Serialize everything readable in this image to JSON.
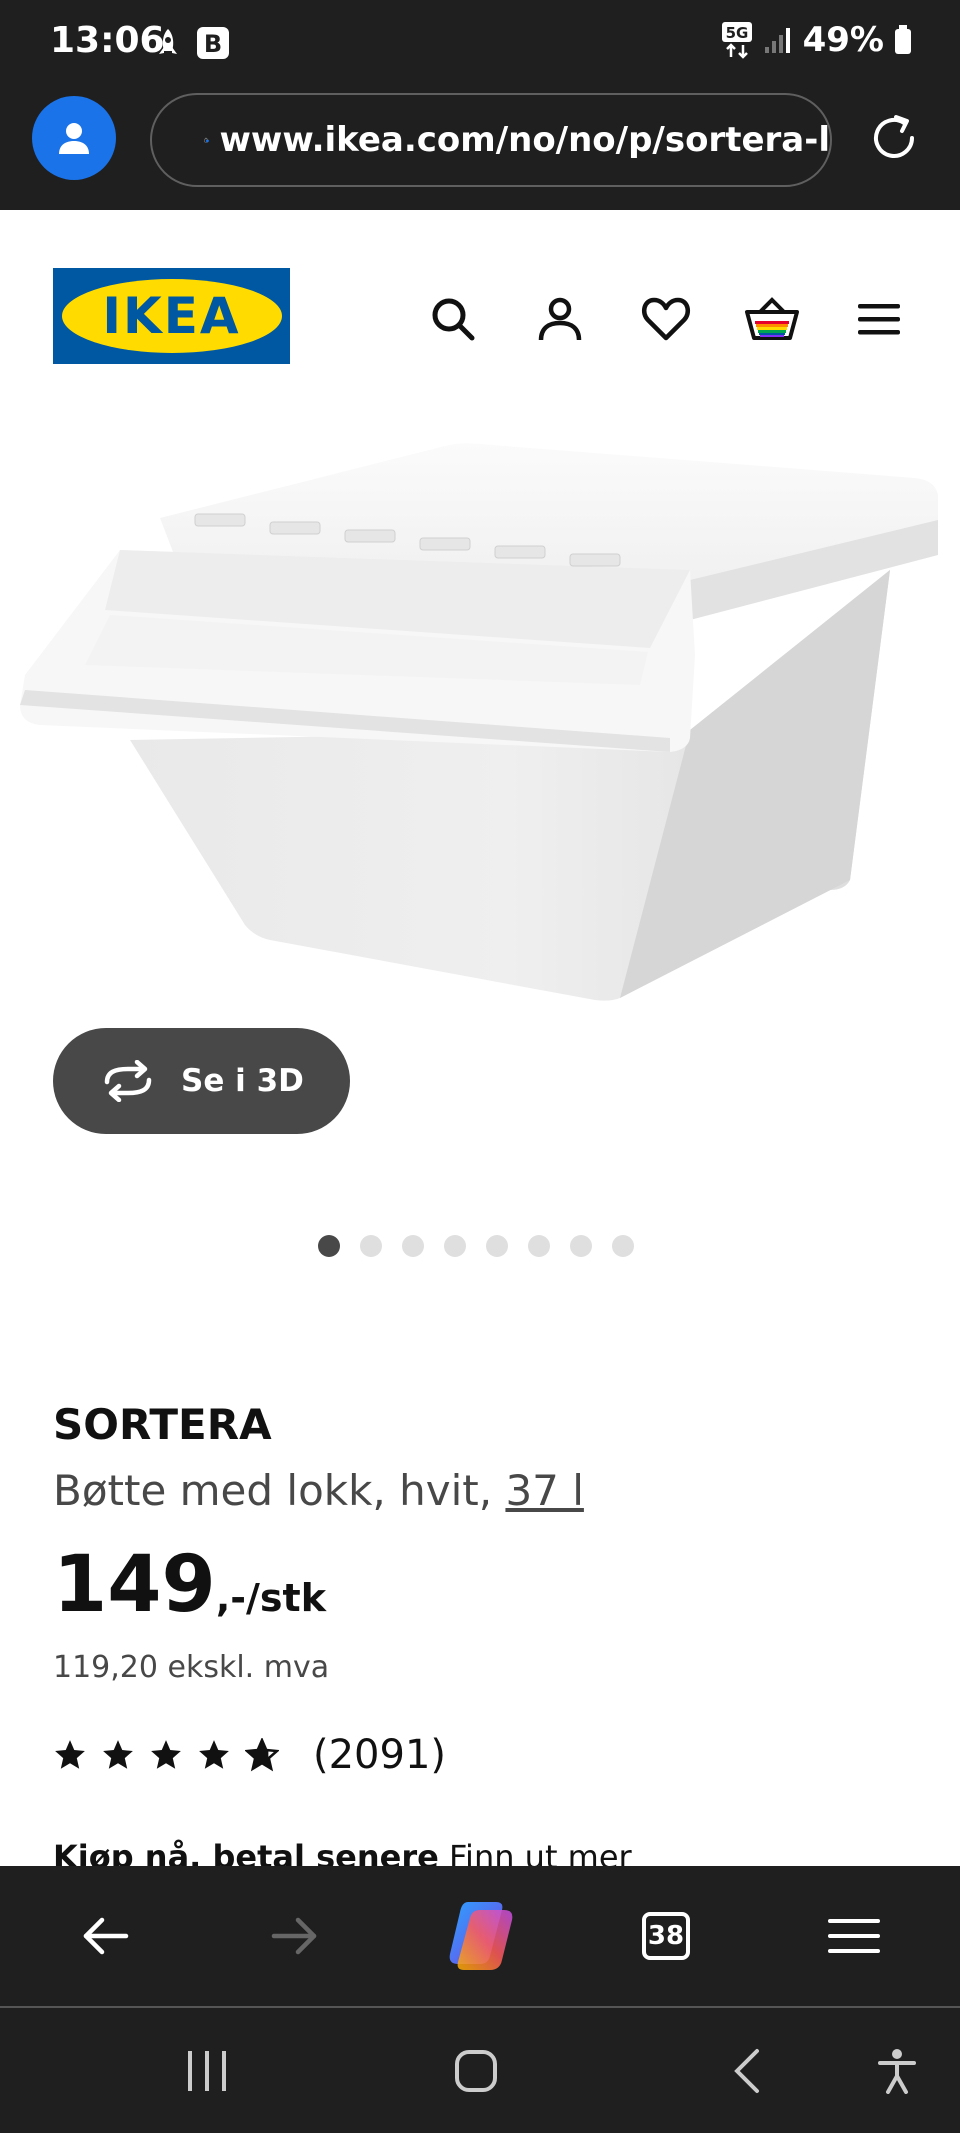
{
  "status_bar": {
    "time": "13:06",
    "network": "5G",
    "battery": "49%"
  },
  "browser": {
    "url": "www.ikea.com/no/no/p/sortera-l",
    "tab_count": "38"
  },
  "header": {
    "logo_text": "IKEA",
    "icons": [
      "search-icon",
      "account-icon",
      "heart-icon",
      "basket-icon",
      "menu-icon"
    ]
  },
  "product": {
    "see_3d_label": "Se i 3D",
    "image_count": 8,
    "active_image": 0,
    "name": "SORTERA",
    "description": "Bøtte med lokk, hvit,",
    "volume": "37 l",
    "price_integer": "149",
    "price_suffix": ",-/stk",
    "price_excl_vat": "119,20 ekskl. mva",
    "rating_stars": 4.5,
    "rating_count": "(2091)",
    "bnpl_link": "Kjøp nå, betal senere",
    "bnpl_more": "Finn ut mer"
  },
  "colors": {
    "ikea_blue": "#0058a3",
    "ikea_yellow": "#ffdb00",
    "chrome_dark": "#1f1f1f",
    "profile_blue": "#1a73e8"
  }
}
